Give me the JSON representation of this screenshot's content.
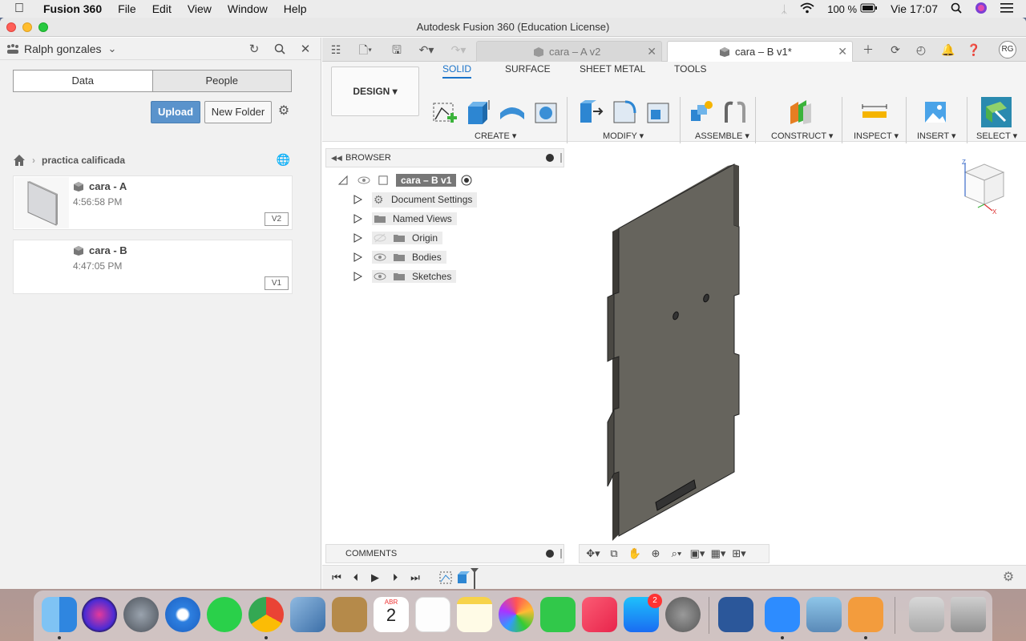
{
  "menubar": {
    "app_name": "Fusion 360",
    "items": [
      "File",
      "Edit",
      "View",
      "Window",
      "Help"
    ],
    "battery": "100 %",
    "clock": "Vie 17:07"
  },
  "window": {
    "title": "Autodesk Fusion 360 (Education License)"
  },
  "datapanel": {
    "user": "Ralph gonzales",
    "tabs": [
      "Data",
      "People"
    ],
    "upload_label": "Upload",
    "new_folder_label": "New Folder",
    "breadcrumb": "practica calificada",
    "files": [
      {
        "name": "cara - A",
        "time": "4:56:58 PM",
        "version": "V2"
      },
      {
        "name": "cara - B",
        "time": "4:47:05 PM",
        "version": "V1"
      }
    ]
  },
  "tabs": {
    "inactive_label": "cara – A v2",
    "active_label": "cara – B v1*",
    "avatar": "RG"
  },
  "ribbon": {
    "design_label": "DESIGN",
    "tabs": [
      "SOLID",
      "SURFACE",
      "SHEET METAL",
      "TOOLS"
    ],
    "groups": [
      "CREATE",
      "MODIFY",
      "ASSEMBLE",
      "CONSTRUCT",
      "INSPECT",
      "INSERT",
      "SELECT"
    ]
  },
  "browser": {
    "title": "BROWSER",
    "root": "cara – B v1",
    "items": [
      "Document Settings",
      "Named Views",
      "Origin",
      "Bodies",
      "Sketches"
    ]
  },
  "comments": {
    "title": "COMMENTS"
  },
  "dock": {
    "calendar_month": "ABR",
    "calendar_day": "2",
    "appstore_badge": "2"
  }
}
